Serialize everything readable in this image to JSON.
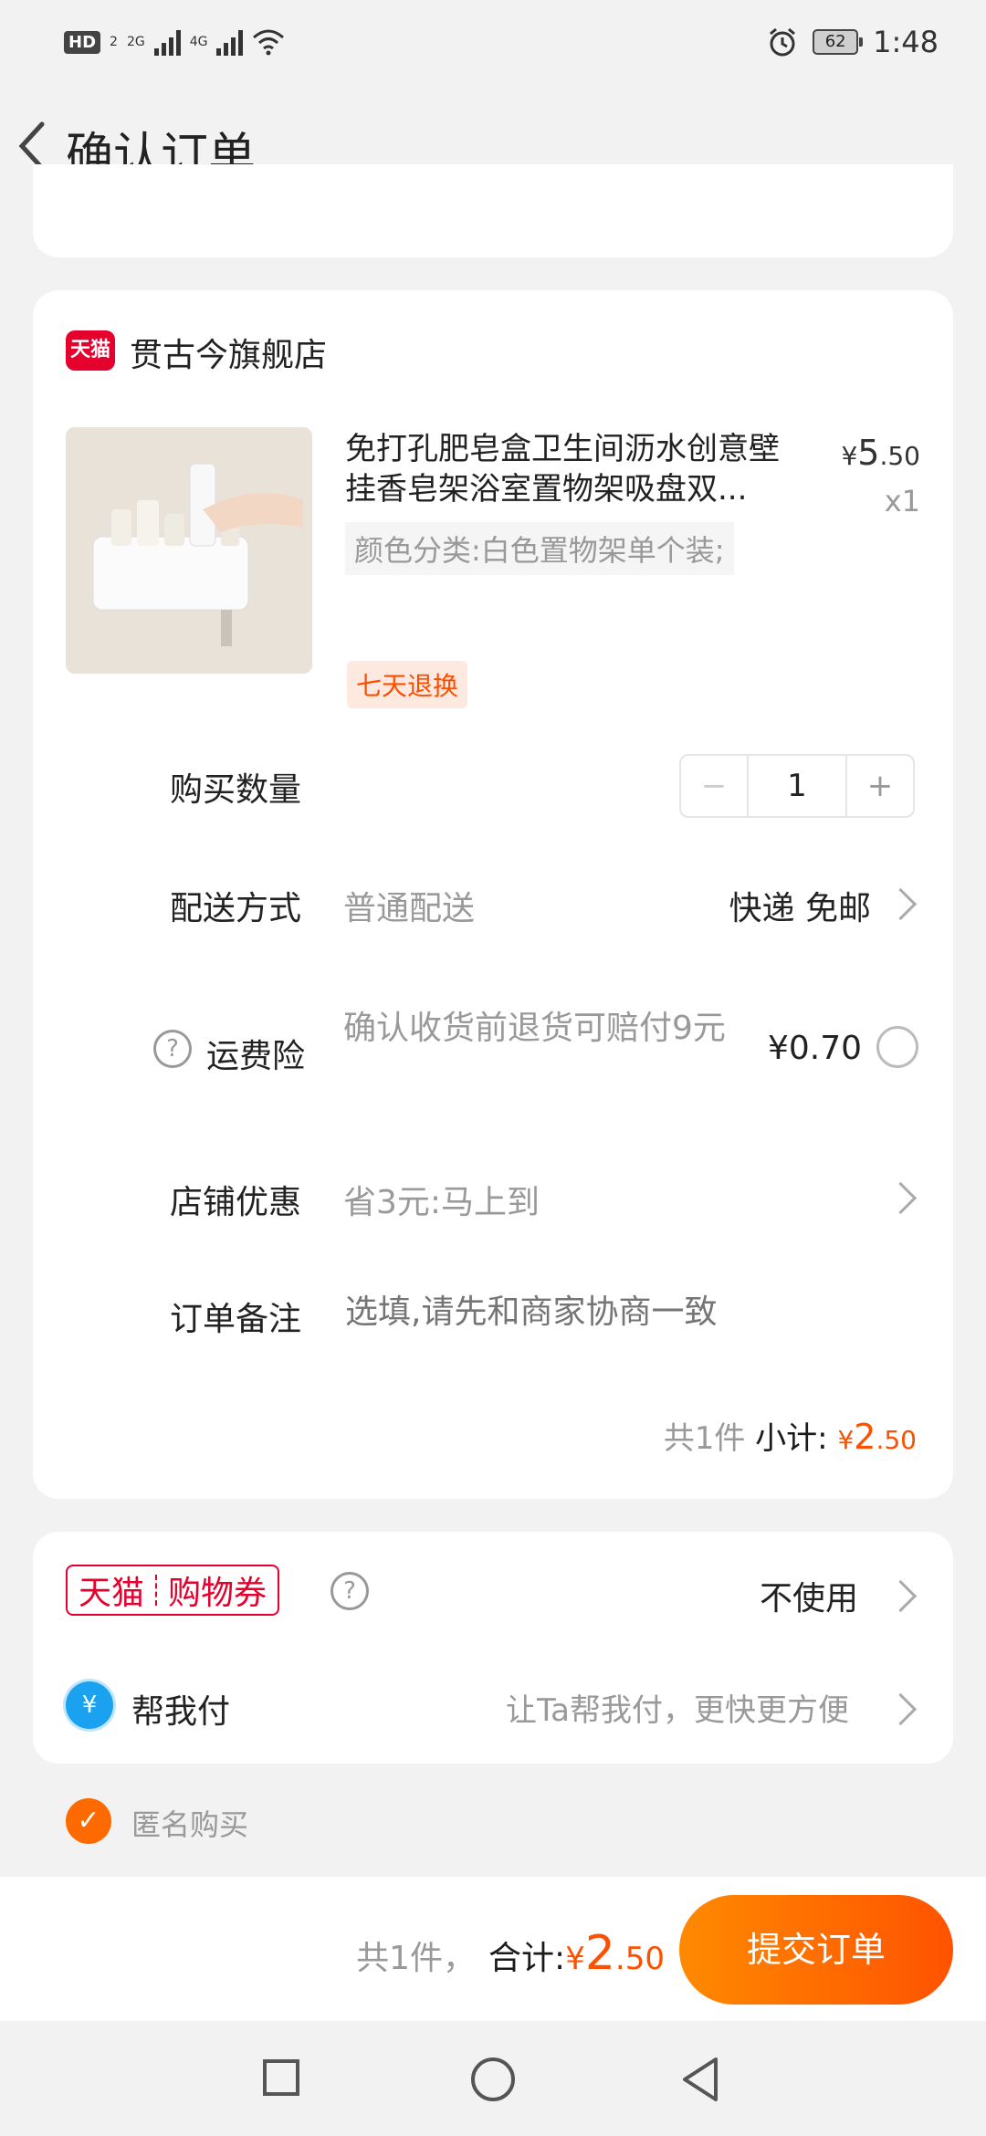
{
  "status_bar": {
    "left_badge": "HD",
    "left_badge_sub": "2",
    "sim1": "2G",
    "sim2": "4G",
    "battery": "62",
    "time": "1:48"
  },
  "header": {
    "title": "确认订单"
  },
  "store": {
    "logo_text": "天猫",
    "name": "贯古今旗舰店",
    "product": {
      "title": "免打孔肥皂盒卫生间沥水创意壁挂香皂架浴室置物架吸盘双...",
      "price_symbol": "¥",
      "price_int": "5",
      "price_dec": ".50",
      "qty": "x1",
      "sku": "颜色分类:白色置物架单个装;",
      "badge": "七天退换"
    },
    "quantity": {
      "label": "购买数量",
      "minus": "−",
      "value": "1",
      "plus": "+"
    },
    "delivery": {
      "label": "配送方式",
      "value": "普通配送",
      "right": "快递 免邮"
    },
    "insurance": {
      "label": "运费险",
      "desc": "确认收货前退货可赔付9元",
      "price": "¥0.70"
    },
    "discount": {
      "label": "店铺优惠",
      "value": "省3元:马上到"
    },
    "note": {
      "label": "订单备注",
      "placeholder": "选填,请先和商家协商一致"
    },
    "subtotal": {
      "count": "共1件",
      "label": "小计:",
      "symbol": "¥",
      "int": "2",
      "dec": ".50"
    }
  },
  "coupon": {
    "left": "天猫",
    "right": "购物券",
    "value": "不使用"
  },
  "help_pay": {
    "icon": "¥",
    "label": "帮我付",
    "desc": "让Ta帮我付，更快更方便"
  },
  "anonymous": {
    "label": "匿名购买"
  },
  "bottom": {
    "count": "共1件，",
    "total_label": "合计:",
    "symbol": "¥",
    "int": "2",
    "dec": ".50",
    "submit": "提交订单"
  },
  "colors": {
    "accent": "#ff5000",
    "tmall_red": "#e5002d"
  }
}
